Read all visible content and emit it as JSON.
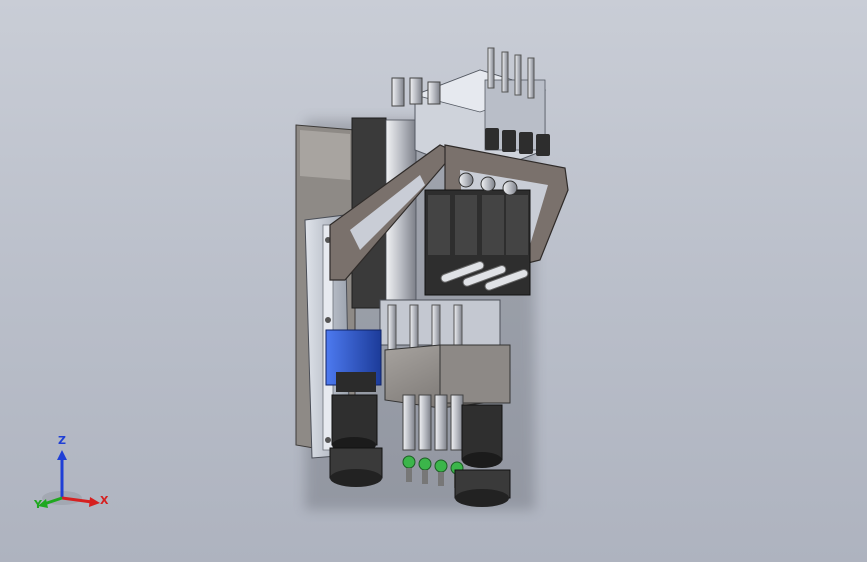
{
  "viewport": {
    "background_top": "#c9cdd6",
    "background_bottom": "#aeb3bf"
  },
  "triad": {
    "z_label": "Z",
    "x_label": "X",
    "y_label": "Y",
    "z_color": "#1f3fd6",
    "x_color": "#d62020",
    "y_color": "#1fa81f"
  },
  "model": {
    "description_icon": "cad-assembly-icon",
    "part_colors": {
      "housing": "#8d8a87",
      "bracket": "#736a66",
      "frame": "#c8cdd8",
      "motor": "#2d5bcf",
      "dark": "#2b2b2b",
      "nozzle_tip": "#3bb54a"
    }
  }
}
